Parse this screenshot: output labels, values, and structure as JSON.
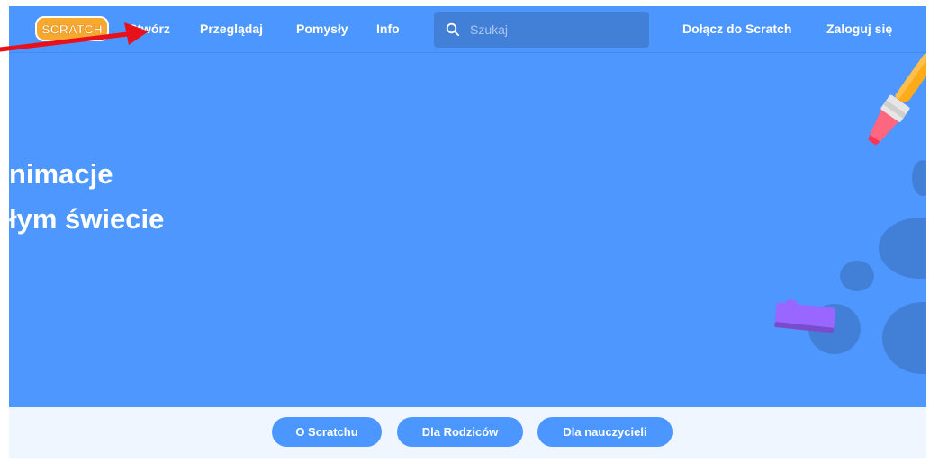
{
  "navbar": {
    "logo_text": "SCRATCH",
    "items": [
      {
        "label": "Stwórz"
      },
      {
        "label": "Przeglądaj"
      },
      {
        "label": "Pomysły"
      },
      {
        "label": "Info"
      }
    ],
    "search": {
      "placeholder": "Szukaj",
      "value": ""
    },
    "join_label": "Dołącz do Scratch",
    "signin_label": "Zaloguj się"
  },
  "hero": {
    "line1": "nimacje",
    "line2": "łym świecie"
  },
  "sub_nav": {
    "items": [
      {
        "label": "O Scratchu"
      },
      {
        "label": "Dla Rodziców"
      },
      {
        "label": "Dla nauczycieli"
      }
    ]
  },
  "colors": {
    "brand_blue": "#4c97ff",
    "search_bg": "#4280d7",
    "sub_bar_bg": "#f0f6ff",
    "logo_orange": "#f7a82f",
    "annotation_red": "#e8111b"
  },
  "icons": {
    "search": "search-icon",
    "brush": "paintbrush-icon",
    "brick": "puzzle-block-icon"
  }
}
